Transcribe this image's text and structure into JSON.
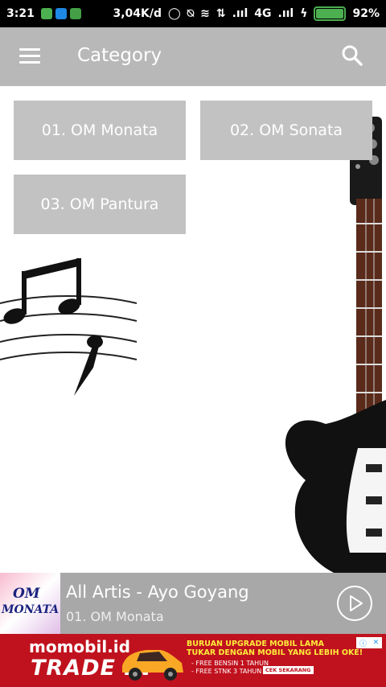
{
  "status_bar": {
    "time": "3:21",
    "speed": "3,04K/d",
    "network_1": ".ııl",
    "network_2": "4G",
    "network_3": ".ııl",
    "battery": "92%",
    "battery_level": 0.92,
    "colors": {
      "battery": "#4caf50"
    }
  },
  "app_bar": {
    "title": "Category",
    "menu_icon": "hamburger-menu-icon",
    "search_icon": "search-icon",
    "background": "#b8b8b8"
  },
  "categories": [
    {
      "label": "01. OM Monata"
    },
    {
      "label": "02. OM Sonata"
    },
    {
      "label": "03. OM Pantura"
    }
  ],
  "player": {
    "album_text_line1": "OM",
    "album_text_line2": "MONATA",
    "title": "All Artis - Ayo Goyang",
    "subtitle": "01. OM Monata",
    "play_icon": "play-circle-icon"
  },
  "ad": {
    "brand": "momobil.id",
    "headline": "TRADE IN",
    "promo_title_1": "BURUAN UPGRADE MOBIL LAMA",
    "promo_title_2": "TUKAR DENGAN MOBIL YANG LEBIH OKE!",
    "promo_line_1": "- FREE BENSIN 1 TAHUN",
    "promo_line_2": "- FREE STNK 3 TAHUN",
    "badge": "CEK SEKARANG",
    "info_icon": "info-icon",
    "close_icon": "close-icon",
    "background": "#c0121e"
  }
}
